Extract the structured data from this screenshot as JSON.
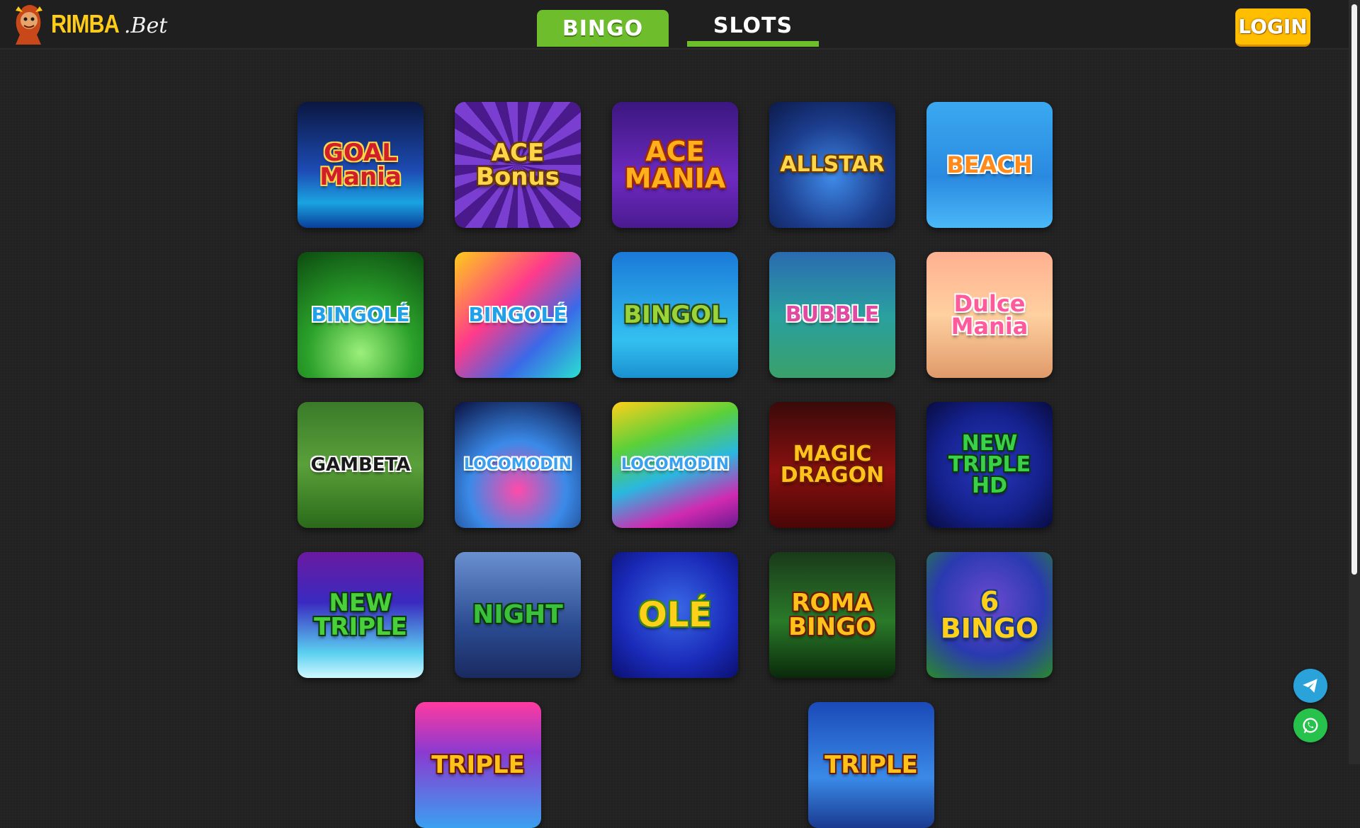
{
  "header": {
    "logo_main": "RIMBA",
    "logo_suffix": ".Bet",
    "tabs": [
      {
        "label": "BINGO",
        "active": true
      },
      {
        "label": "SLOTS",
        "active": false
      }
    ],
    "login_label": "LOGIN"
  },
  "games": [
    {
      "title": "GOAL\nMania",
      "bg": "linear-gradient(180deg,#0a1740 0%,#1d4cb5 55%,#1aa3e0 80%,#0a3e9a 100%)",
      "color": "#d01e2a",
      "stroke": "#ffd54a",
      "size": 34
    },
    {
      "title": "ACE\nBonus",
      "bg": "repeating-conic-gradient(from 0deg at 50% 50%,#4a1a8c 0 10deg,#7a3fd0 10deg 20deg)",
      "color": "#ffd54a",
      "stroke": "#6a3a00",
      "size": 34
    },
    {
      "title": "ACE\nMANIA",
      "bg": "linear-gradient(180deg,#3b1780 0%,#6e2ac0 60%,#4a1a90 100%)",
      "color": "#ffb01a",
      "stroke": "#a12a00",
      "size": 38
    },
    {
      "title": "ALLSTAR",
      "bg": "radial-gradient(circle at 50% 60%,#3e8ae8 0%,#1c3c8c 55%,#0b1a4a 100%)",
      "color": "#ffd54a",
      "stroke": "#6a3a00",
      "size": 30
    },
    {
      "title": "BEACH",
      "bg": "linear-gradient(180deg,#3aa8f0 0%,#2a8ae0 60%,#4ab8f8 100%)",
      "color": "#ff8a1a",
      "stroke": "#ffffff",
      "size": 32
    },
    {
      "title": "BINGOLÉ",
      "bg": "radial-gradient(circle at 50% 80%,#9cf07a 0%,#2aa02a 45%,#0c4a10 100%)",
      "color": "#22a0e8",
      "stroke": "#ffffff",
      "size": 28
    },
    {
      "title": "BINGOLÉ",
      "bg": "linear-gradient(135deg,#ffcc1a 0%,#ff3a8a 40%,#3a6ae8 70%,#2ae0d0 100%)",
      "color": "#22a0e8",
      "stroke": "#ffffff",
      "size": 28
    },
    {
      "title": "BINGOL",
      "bg": "linear-gradient(180deg,#1a7ad8 0%,#34c0f0 70%,#1a90d0 100%)",
      "color": "#9ad43a",
      "stroke": "#2a4a10",
      "size": 34
    },
    {
      "title": "BUBBLE",
      "bg": "linear-gradient(180deg,#2a6ab0 0%,#2aa0a0 50%,#3aa06a 100%)",
      "color": "#e04aa0",
      "stroke": "#ffffff",
      "size": 30
    },
    {
      "title": "Dulce\nMania",
      "bg": "linear-gradient(180deg,#ffb090 0%,#ffd0a0 50%,#e09a6a 100%)",
      "color": "#ff5a9a",
      "stroke": "#ffffff",
      "size": 32
    },
    {
      "title": "GAMBETA",
      "bg": "linear-gradient(180deg,#3a7a2a 0%,#5aa03a 50%,#2a6a1a 100%)",
      "color": "#1a1a1a",
      "stroke": "#ffffff",
      "size": 26
    },
    {
      "title": "LOCOMODIN",
      "bg": "radial-gradient(circle at 50% 70%,#ff4aaa 0%,#3a8ae8 45%,#0a1040 100%)",
      "color": "#3aa0f0",
      "stroke": "#ffffff",
      "size": 22
    },
    {
      "title": "LOCOMODIN",
      "bg": "linear-gradient(160deg,#ffd01a 0%,#5ad03a 30%,#2ab8e0 55%,#d02ab0 80%,#6a1a90 100%)",
      "color": "#3aa0f0",
      "stroke": "#ffffff",
      "size": 22
    },
    {
      "title": "MAGIC\nDRAGON",
      "bg": "linear-gradient(180deg,#3a0a0a 0%,#8a1010 55%,#4a0606 100%)",
      "color": "#ffc21a",
      "stroke": "#6a1a00",
      "size": 30
    },
    {
      "title": "NEW\nTRIPLE HD",
      "bg": "radial-gradient(circle at 50% 50%,#2a3ac0 0%,#14208a 60%,#080c40 100%)",
      "color": "#3ad04a",
      "stroke": "#0a3a0a",
      "size": 30
    },
    {
      "title": "NEW\nTRIPLE",
      "bg": "linear-gradient(180deg,#6a1aa0 0%,#3a2ac0 40%,#5ad0f0 80%,#d0f8ff 100%)",
      "color": "#4ad03a",
      "stroke": "#0a3a0a",
      "size": 34
    },
    {
      "title": "NIGHT",
      "bg": "linear-gradient(180deg,#6a90d0 0%,#2a4a90 60%,#1a2a60 100%)",
      "color": "#3ac03a",
      "stroke": "#0a3a0a",
      "size": 36
    },
    {
      "title": "OLÉ",
      "bg": "radial-gradient(circle at 50% 45%,#3a6ae8 0%,#1a2ab8 60%,#0a1070 100%)",
      "color": "#ffd01a",
      "stroke": "#3a8a10",
      "size": 48
    },
    {
      "title": "ROMA\nBINGO",
      "bg": "linear-gradient(180deg,#1a3a1a 0%,#2a7a2a 55%,#0a2a0a 100%)",
      "color": "#ffc21a",
      "stroke": "#6a1a00",
      "size": 34
    },
    {
      "title": "6\nBINGO",
      "bg": "radial-gradient(circle at 50% 40%,#6a4ad0 0%,#2a3ab0 55%,#2a8a2a 100%)",
      "color": "#ffd01a",
      "stroke": "#1a3a8a",
      "size": 38
    },
    {
      "title": "TRIPLE",
      "bg": "linear-gradient(180deg,#ff3aa0 0%,#8a3ad0 40%,#3aa0f0 100%)",
      "color": "#ffc21a",
      "stroke": "#6a1a00",
      "size": 34
    },
    {
      "title": "TRIPLE",
      "bg": "linear-gradient(180deg,#1a4ab8 0%,#3a8ae8 60%,#1a3a90 100%)",
      "color": "#ffc21a",
      "stroke": "#6a1a00",
      "size": 34
    }
  ],
  "floating": {
    "telegram": "telegram-icon",
    "whatsapp": "whatsapp-icon"
  }
}
